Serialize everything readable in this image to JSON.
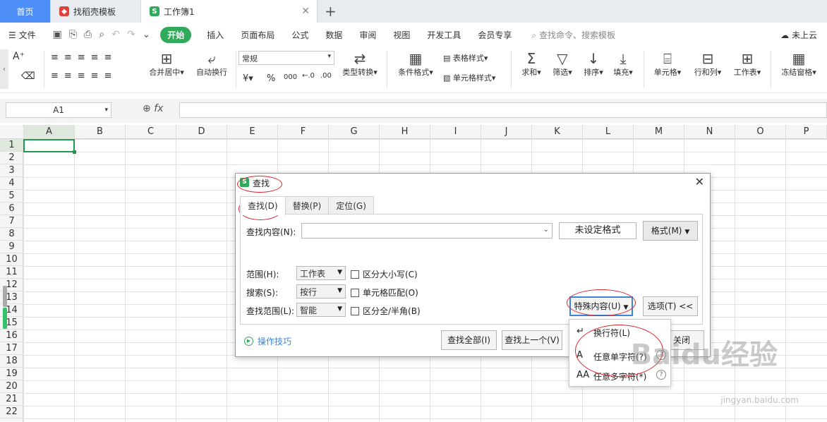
{
  "tabs": {
    "home": "首页",
    "doc": "找稻壳模板",
    "active": "工作簿1",
    "plus": "+"
  },
  "menubar": {
    "file": "文件",
    "start": "开始",
    "items": [
      "插入",
      "页面布局",
      "公式",
      "数据",
      "审阅",
      "视图",
      "开发工具",
      "会员专享"
    ],
    "search": "查找命令、搜索模板",
    "cloud": "未上云"
  },
  "ribbon": {
    "number_format": "常规",
    "merge": "合并居中",
    "wrap": "自动换行",
    "convert": "类型转换",
    "cond_format": "条件格式",
    "table_style": "表格样式",
    "cell_style": "单元格样式",
    "sum": "求和",
    "filter": "筛选",
    "sort": "排序",
    "fill": "填充",
    "cell": "单元格",
    "rowcol": "行和列",
    "sheet": "工作表",
    "freeze": "冻结窗格",
    "currency": "¥",
    "percent": "%",
    "thousand": "000"
  },
  "formula_bar": {
    "name_box": "A1",
    "fx": "fx"
  },
  "columns": [
    "A",
    "B",
    "C",
    "D",
    "E",
    "F",
    "G",
    "H",
    "I",
    "J",
    "K",
    "L",
    "M",
    "N",
    "O",
    "P"
  ],
  "rows": [
    "1",
    "2",
    "3",
    "4",
    "5",
    "6",
    "7",
    "8",
    "9",
    "10",
    "11",
    "12",
    "13",
    "14",
    "15",
    "16",
    "17",
    "18",
    "19",
    "20",
    "21",
    "22"
  ],
  "dialog": {
    "title": "查找",
    "tabs": [
      "查找(D)",
      "替换(P)",
      "定位(G)"
    ],
    "find_label": "查找内容(N):",
    "find_value": "",
    "no_format": "未设定格式",
    "format_btn": "格式(M)",
    "scope_label": "范围(H):",
    "scope_value": "工作表",
    "search_label": "搜索(S):",
    "search_value": "按行",
    "lookin_label": "查找范围(L):",
    "lookin_value": "智能",
    "match_case": "区分大小写(C)",
    "match_cell": "单元格匹配(O)",
    "match_width": "区分全/半角(B)",
    "special_btn": "特殊内容(U)",
    "options_btn": "选项(T) <<",
    "tips": "操作技巧",
    "find_all": "查找全部(I)",
    "find_prev": "查找上一个(V)",
    "close": "关闭"
  },
  "special_menu": [
    {
      "icon": "↵",
      "label": "换行符(L)"
    },
    {
      "icon": "A",
      "label": "任意单字符(?)"
    },
    {
      "icon": "AA",
      "label": "任意多字符(*)"
    }
  ],
  "watermark": "Baidu经验",
  "watermark_url": "jingyan.baidu.com"
}
